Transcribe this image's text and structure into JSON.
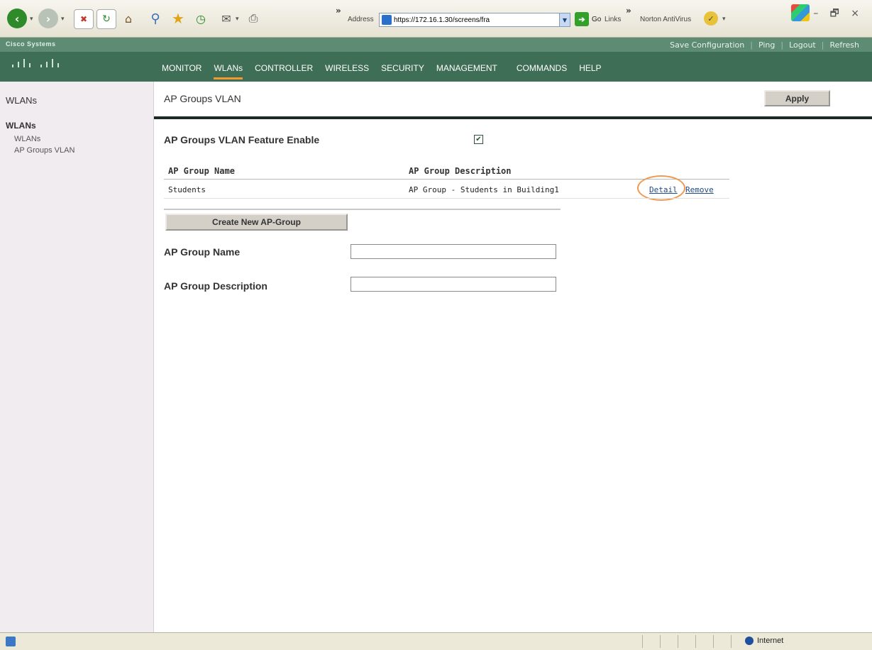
{
  "browser": {
    "address_label": "Address",
    "address_url": "https://172.16.1.30/screens/fra",
    "go_label": "Go",
    "links_label": "Links",
    "norton_label": "Norton AntiVirus",
    "window_controls": "– 🗗 ×"
  },
  "header": {
    "brand": "Cisco Systems",
    "utility_links": [
      "Save Configuration",
      "Ping",
      "Logout",
      "Refresh"
    ],
    "nav": [
      "MONITOR",
      "WLANs",
      "CONTROLLER",
      "WIRELESS",
      "SECURITY",
      "MANAGEMENT",
      "COMMANDS",
      "HELP"
    ],
    "active_nav": "WLANs",
    "accent_color": "#f29a2e",
    "header_color": "#3f6e57"
  },
  "sidebar": {
    "title": "WLANs",
    "section": "WLANs",
    "items": [
      "WLANs",
      "AP Groups VLAN"
    ]
  },
  "main": {
    "title": "AP Groups VLAN",
    "apply_label": "Apply",
    "feature_label": "AP Groups VLAN Feature Enable",
    "feature_enabled": true,
    "table": {
      "headers": [
        "AP Group Name",
        "AP Group Description"
      ],
      "rows": [
        {
          "name": "Students",
          "description": "AP Group - Students in Building1",
          "detail": "Detail",
          "remove": "Remove"
        }
      ]
    },
    "create_label": "Create New AP-Group",
    "name_label": "AP Group Name",
    "name_value": "",
    "description_label": "AP Group Description",
    "description_value": ""
  },
  "status": {
    "zone": "Internet"
  }
}
